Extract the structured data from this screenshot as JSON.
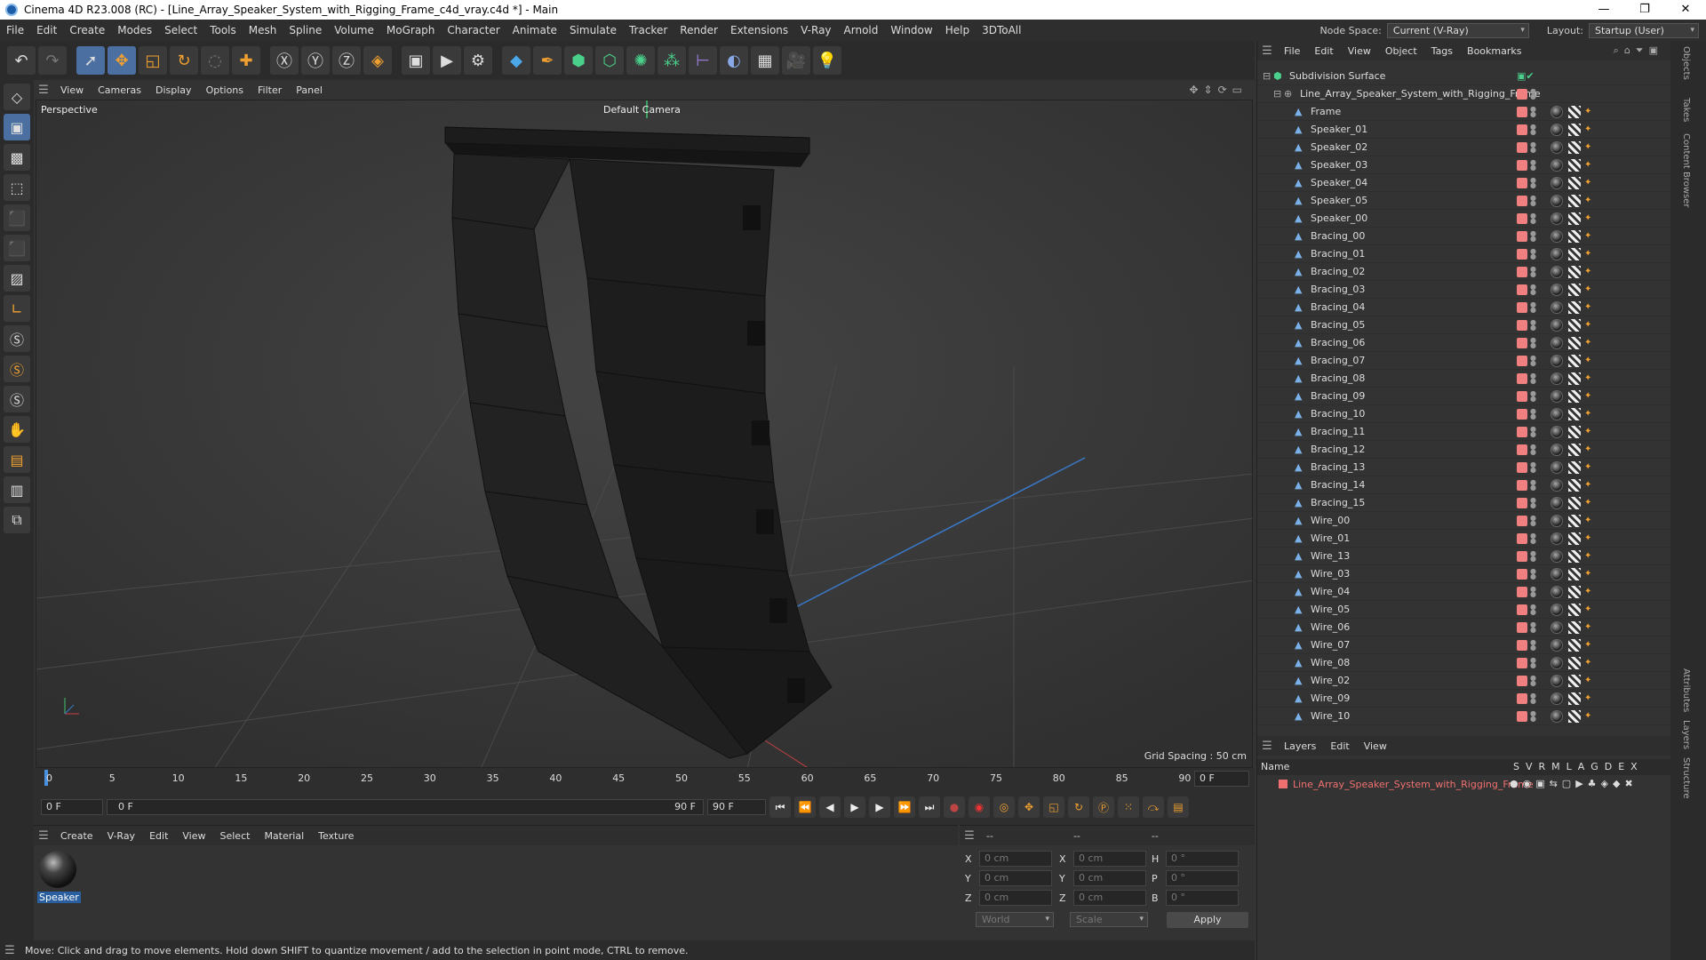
{
  "window": {
    "title": "Cinema 4D R23.008 (RC) - [Line_Array_Speaker_System_with_Rigging_Frame_c4d_vray.c4d *] - Main",
    "min": "—",
    "max": "❐",
    "close": "✕"
  },
  "menus": [
    "File",
    "Edit",
    "Create",
    "Modes",
    "Select",
    "Tools",
    "Mesh",
    "Spline",
    "Volume",
    "MoGraph",
    "Character",
    "Animate",
    "Simulate",
    "Tracker",
    "Render",
    "Extensions",
    "V-Ray",
    "Arnold",
    "Window",
    "Help",
    "3DToAll"
  ],
  "nodespace": {
    "label": "Node Space:",
    "value": "Current (V-Ray)"
  },
  "layout": {
    "label": "Layout:",
    "value": "Startup (User)"
  },
  "viewport": {
    "menus": [
      "View",
      "Cameras",
      "Display",
      "Options",
      "Filter",
      "Panel"
    ],
    "label": "Perspective",
    "camera": "Default Camera",
    "grid": "Grid Spacing : 50 cm"
  },
  "timeline": {
    "ticks": [
      "0",
      "5",
      "10",
      "15",
      "20",
      "25",
      "30",
      "35",
      "40",
      "45",
      "50",
      "55",
      "60",
      "65",
      "70",
      "75",
      "80",
      "85",
      "90"
    ],
    "current": "0 F",
    "start": "0 F",
    "range_start": "0 F",
    "range_end": "90 F",
    "end": "90 F"
  },
  "material": {
    "menus": [
      "Create",
      "V-Ray",
      "Edit",
      "View",
      "Select",
      "Material",
      "Texture"
    ],
    "name": "Speaker"
  },
  "coords": {
    "headers": [
      "--",
      "--",
      "--"
    ],
    "x": "0 cm",
    "y": "0 cm",
    "z": "0 cm",
    "sx": "0 cm",
    "sy": "0 cm",
    "sz": "0 cm",
    "h": "0 °",
    "p": "0 °",
    "b": "0 °",
    "world": "World",
    "scale": "Scale",
    "apply": "Apply"
  },
  "status": "Move: Click and drag to move elements. Hold down SHIFT to quantize movement / add to the selection in point mode, CTRL to remove.",
  "objects": {
    "menus": [
      "File",
      "Edit",
      "View",
      "Object",
      "Tags",
      "Bookmarks"
    ],
    "root": "Subdivision Surface",
    "group": "Line_Array_Speaker_System_with_Rigging_Frame",
    "items": [
      "Frame",
      "Speaker_01",
      "Speaker_02",
      "Speaker_03",
      "Speaker_04",
      "Speaker_05",
      "Speaker_00",
      "Bracing_00",
      "Bracing_01",
      "Bracing_02",
      "Bracing_03",
      "Bracing_04",
      "Bracing_05",
      "Bracing_06",
      "Bracing_07",
      "Bracing_08",
      "Bracing_09",
      "Bracing_10",
      "Bracing_11",
      "Bracing_12",
      "Bracing_13",
      "Bracing_14",
      "Bracing_15",
      "Wire_00",
      "Wire_01",
      "Wire_13",
      "Wire_03",
      "Wire_04",
      "Wire_05",
      "Wire_06",
      "Wire_07",
      "Wire_08",
      "Wire_02",
      "Wire_09",
      "Wire_10"
    ]
  },
  "layers": {
    "menus": [
      "Layers",
      "Edit",
      "View"
    ],
    "name_header": "Name",
    "cols": "S  V  R  M  L  A  G  D  E  X",
    "layer": "Line_Array_Speaker_System_with_Rigging_Frame"
  },
  "rail": [
    "Objects",
    "Takes",
    "Content Browser",
    "Attributes",
    "Layers",
    "Structure"
  ]
}
